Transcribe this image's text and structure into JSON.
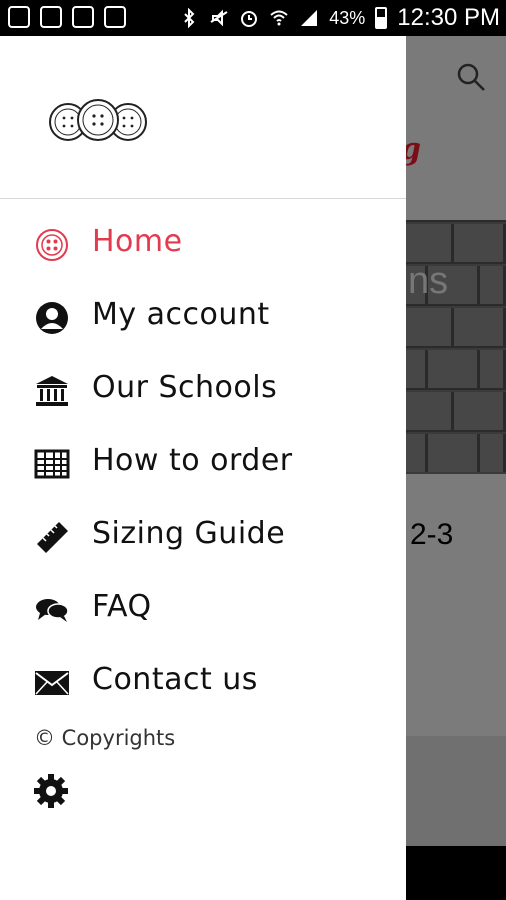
{
  "status_bar": {
    "battery_percent": "43%",
    "time": "12:30 PM",
    "icons": [
      "notification-icon",
      "image-icon",
      "gmail-icon",
      "app-icon",
      "bluetooth-icon",
      "mute-icon",
      "alarm-icon",
      "wifi-icon",
      "signal-icon",
      "battery-icon"
    ]
  },
  "drawer": {
    "logo_icon": "buttons-logo-icon",
    "menu": [
      {
        "label": "Home",
        "icon": "home-button-icon",
        "active": true
      },
      {
        "label": "My account",
        "icon": "user-icon",
        "active": false
      },
      {
        "label": "Our Schools",
        "icon": "school-building-icon",
        "active": false
      },
      {
        "label": "How to order",
        "icon": "table-icon",
        "active": false
      },
      {
        "label": "Sizing Guide",
        "icon": "ruler-icon",
        "active": false
      },
      {
        "label": "FAQ",
        "icon": "chat-bubbles-icon",
        "active": false
      },
      {
        "label": "Contact us",
        "icon": "envelope-icon",
        "active": false
      }
    ],
    "copyright": "© Copyrights",
    "settings_icon": "gear-icon"
  },
  "background_app": {
    "banner_text": "ns",
    "size_text": "2-3",
    "accent_color": "#e23a4e"
  }
}
